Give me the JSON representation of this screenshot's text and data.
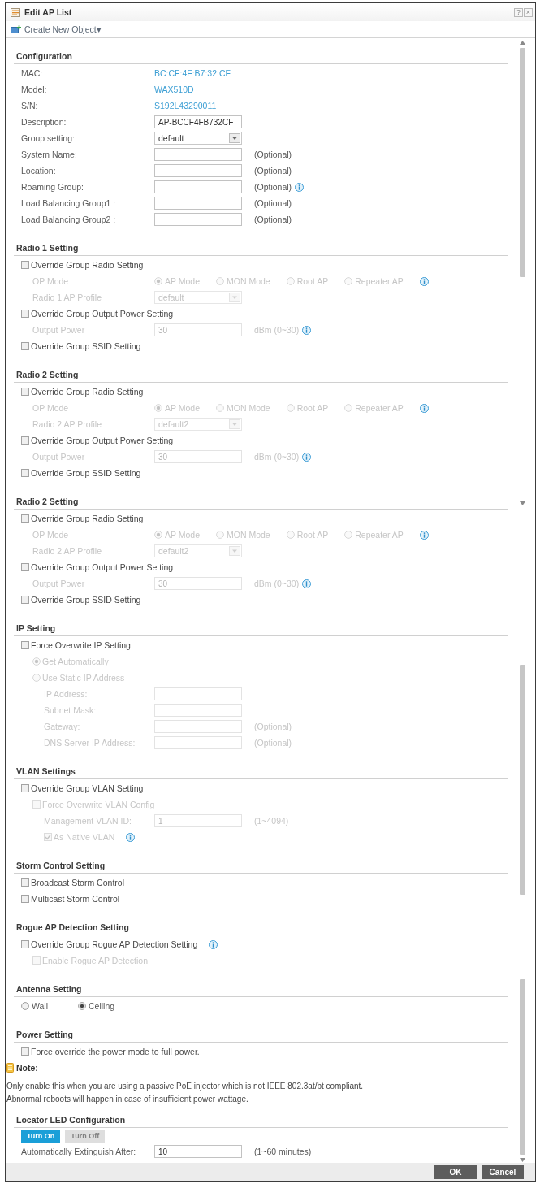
{
  "window": {
    "title": "Edit AP List",
    "help": "?",
    "close": "×"
  },
  "toolbar": {
    "create_new_object": "Create New Object▾"
  },
  "blocks": [
    {
      "kind": "section",
      "title": "Configuration",
      "rows": [
        {
          "kind": "info",
          "label": "MAC:",
          "value": "BC:CF:4F:B7:32:CF"
        },
        {
          "kind": "info",
          "label": "Model:",
          "value": "WAX510D"
        },
        {
          "kind": "info",
          "label": "S/N:",
          "value": "S192L43290011"
        },
        {
          "kind": "input",
          "label": "Description:",
          "value": "AP-BCCF4FB732CF",
          "disabled": false
        },
        {
          "kind": "select",
          "label": "Group setting:",
          "value": "default",
          "disabled": false
        },
        {
          "kind": "input",
          "label": "System Name:",
          "suffix": "(Optional)",
          "disabled": false
        },
        {
          "kind": "input",
          "label": "Location:",
          "suffix": "(Optional)",
          "disabled": false
        },
        {
          "kind": "input",
          "label": "Roaming Group:",
          "suffix": "(Optional)",
          "info": true,
          "disabled": false
        },
        {
          "kind": "input",
          "label": "Load Balancing Group1 :",
          "suffix": "(Optional)",
          "disabled": false
        },
        {
          "kind": "input",
          "label": "Load Balancing Group2 :",
          "suffix": "(Optional)",
          "disabled": false
        }
      ]
    },
    {
      "kind": "section",
      "title": "Radio 1 Setting",
      "rows": [
        {
          "kind": "checkbox",
          "label": "Override Group Radio Setting",
          "checked": false,
          "disabled": false,
          "children": [
            {
              "kind": "radios",
              "label": "OP Mode",
              "disabled": true,
              "info": true,
              "options": [
                {
                  "label": "AP Mode",
                  "selected": true
                },
                {
                  "label": "MON Mode",
                  "selected": false
                },
                {
                  "label": "Root AP",
                  "selected": false
                },
                {
                  "label": "Repeater AP",
                  "selected": false
                }
              ]
            },
            {
              "kind": "select",
              "label": "Radio 1 AP Profile",
              "value": "default",
              "disabled": true
            }
          ]
        },
        {
          "kind": "checkbox",
          "label": "Override Group Output Power Setting",
          "checked": false,
          "disabled": false,
          "children": [
            {
              "kind": "input",
              "label": "Output Power",
              "value": "30",
              "suffix": "dBm (0~30)",
              "info": true,
              "disabled": true
            }
          ]
        },
        {
          "kind": "checkbox",
          "label": "Override Group SSID Setting",
          "checked": false,
          "disabled": false
        }
      ]
    },
    {
      "kind": "section",
      "title": "Radio 2 Setting",
      "rows": [
        {
          "kind": "checkbox",
          "label": "Override Group Radio Setting",
          "checked": false,
          "disabled": false,
          "children": [
            {
              "kind": "radios",
              "label": "OP Mode",
              "disabled": true,
              "info": true,
              "options": [
                {
                  "label": "AP Mode",
                  "selected": true
                },
                {
                  "label": "MON Mode",
                  "selected": false
                },
                {
                  "label": "Root AP",
                  "selected": false
                },
                {
                  "label": "Repeater AP",
                  "selected": false
                }
              ]
            },
            {
              "kind": "select",
              "label": "Radio 2 AP Profile",
              "value": "default2",
              "disabled": true
            }
          ]
        },
        {
          "kind": "checkbox",
          "label": "Override Group Output Power Setting",
          "checked": false,
          "disabled": false,
          "children": [
            {
              "kind": "input",
              "label": "Output Power",
              "value": "30",
              "suffix": "dBm (0~30)",
              "info": true,
              "disabled": true
            }
          ]
        },
        {
          "kind": "checkbox",
          "label": "Override Group SSID Setting",
          "checked": false,
          "disabled": false
        }
      ]
    },
    {
      "kind": "section",
      "title": "Radio 2 Setting",
      "rows": [
        {
          "kind": "checkbox",
          "label": "Override Group Radio Setting",
          "checked": false,
          "disabled": false,
          "children": [
            {
              "kind": "radios",
              "label": "OP Mode",
              "disabled": true,
              "info": true,
              "options": [
                {
                  "label": "AP Mode",
                  "selected": true
                },
                {
                  "label": "MON Mode",
                  "selected": false
                },
                {
                  "label": "Root AP",
                  "selected": false
                },
                {
                  "label": "Repeater AP",
                  "selected": false
                }
              ]
            },
            {
              "kind": "select",
              "label": "Radio 2 AP Profile",
              "value": "default2",
              "disabled": true
            }
          ]
        },
        {
          "kind": "checkbox",
          "label": "Override Group Output Power Setting",
          "checked": false,
          "disabled": false,
          "children": [
            {
              "kind": "input",
              "label": "Output Power",
              "value": "30",
              "suffix": "dBm (0~30)",
              "info": true,
              "disabled": true
            }
          ]
        },
        {
          "kind": "checkbox",
          "label": "Override Group SSID Setting",
          "checked": false,
          "disabled": false
        }
      ]
    },
    {
      "kind": "section",
      "title": "IP Setting",
      "rows": [
        {
          "kind": "checkbox",
          "label": "Force Overwrite IP Setting",
          "checked": false,
          "disabled": false,
          "children": [
            {
              "kind": "radio",
              "label": "Get Automatically",
              "selected": true,
              "disabled": true
            },
            {
              "kind": "radio",
              "label": "Use Static IP Address",
              "selected": false,
              "disabled": true,
              "children": [
                {
                  "kind": "input",
                  "label": "IP Address:",
                  "disabled": true
                },
                {
                  "kind": "input",
                  "label": "Subnet Mask:",
                  "disabled": true
                },
                {
                  "kind": "input",
                  "label": "Gateway:",
                  "suffix": "(Optional)",
                  "disabled": true
                },
                {
                  "kind": "input",
                  "label": "DNS Server IP Address:",
                  "suffix": "(Optional)",
                  "disabled": true
                }
              ]
            }
          ]
        }
      ]
    },
    {
      "kind": "section",
      "title": "VLAN Settings",
      "rows": [
        {
          "kind": "checkbox",
          "label": "Override Group VLAN Setting",
          "checked": false,
          "disabled": false,
          "children": [
            {
              "kind": "checkbox",
              "label": "Force Overwrite VLAN Config",
              "checked": false,
              "disabled": true,
              "children": [
                {
                  "kind": "input",
                  "label": "Management VLAN ID:",
                  "value": "1",
                  "suffix": "(1~4094)",
                  "disabled": true
                },
                {
                  "kind": "checkbox",
                  "label": "As Native VLAN",
                  "checked": true,
                  "disabled": true,
                  "info": true
                }
              ]
            }
          ]
        }
      ]
    },
    {
      "kind": "section",
      "title": "Storm Control Setting",
      "rows": [
        {
          "kind": "checkbox",
          "label": "Broadcast Storm Control",
          "checked": false,
          "disabled": false
        },
        {
          "kind": "checkbox",
          "label": "Multicast Storm Control",
          "checked": false,
          "disabled": false
        }
      ]
    },
    {
      "kind": "section",
      "title": "Rogue AP Detection Setting",
      "rows": [
        {
          "kind": "checkbox",
          "label": "Override Group Rogue AP Detection Setting",
          "checked": false,
          "disabled": false,
          "info": true,
          "children": [
            {
              "kind": "checkbox",
              "label": "Enable Rogue AP Detection",
              "checked": false,
              "disabled": true
            }
          ]
        }
      ]
    },
    {
      "kind": "section",
      "title": "Antenna Setting",
      "rows": [
        {
          "kind": "radios",
          "disabled": false,
          "options": [
            {
              "label": "Wall",
              "selected": false
            },
            {
              "label": "Ceiling",
              "selected": true
            }
          ]
        }
      ]
    },
    {
      "kind": "section",
      "title": "Power Setting",
      "rows": [
        {
          "kind": "checkbox",
          "label": "Force override the power mode to full power.",
          "checked": false,
          "disabled": false
        }
      ]
    },
    {
      "kind": "note",
      "title": "Note:",
      "lines": [
        "Only enable this when you are using a passive PoE injector which is not IEEE 802.3at/bt compliant.",
        "Abnormal reboots will happen in case of insufficient power wattage."
      ]
    },
    {
      "kind": "section",
      "title": "Locator LED Configuration",
      "rows": [
        {
          "kind": "buttons",
          "buttons": [
            {
              "label": "Turn On",
              "disabled": false
            },
            {
              "label": "Turn Off",
              "disabled": true
            }
          ]
        },
        {
          "kind": "input",
          "label": "Automatically Extinguish After:",
          "value": "10",
          "suffix": "(1~60 minutes)",
          "disabled": false
        }
      ]
    }
  ],
  "footer": {
    "buttons": [
      "OK",
      "Cancel"
    ]
  }
}
